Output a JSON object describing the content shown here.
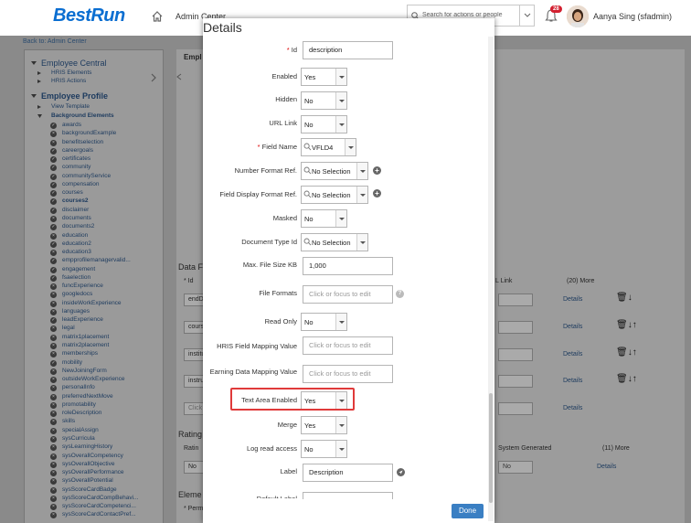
{
  "header": {
    "logo": "BestRun",
    "title": "Admin Center",
    "search_placeholder": "Search for actions or people",
    "notification_count": "28",
    "user_name": "Aanya Sing (sfadmin)"
  },
  "back_link": "Back to: Admin Center",
  "sidebar": {
    "sections": [
      {
        "label": "Employee Central",
        "items": [
          "HRIS Elements",
          "HRIS Actions"
        ]
      },
      {
        "label": "Employee Profile",
        "items": [
          "View Template",
          "Background Elements"
        ]
      }
    ],
    "background_elements": [
      "awards",
      "backgroundExample",
      "benefitselection",
      "careergoals",
      "certificates",
      "community",
      "communityService",
      "compensation",
      "courses",
      "courses2",
      "disclaimer",
      "documents",
      "documents2",
      "education",
      "education2",
      "education3",
      "empprofilemanagervalid...",
      "engagement",
      "fsaelection",
      "funcExperience",
      "googledocs",
      "insideWorkExperience",
      "languages",
      "leadExperience",
      "legal",
      "matrix1placement",
      "matrix2placement",
      "memberships",
      "mobility",
      "NewJoiningForm",
      "outsideWorkExperience",
      "personalInfo",
      "preferredNextMove",
      "promotability",
      "roleDescription",
      "skills",
      "specialAssign",
      "sysCurricula",
      "sysLearningHistory",
      "sysOverallCompetency",
      "sysOverallObjective",
      "sysOverallPerformance",
      "sysOverallPotential",
      "sysScoreCardBadge",
      "sysScoreCardCompBehavi...",
      "sysScoreCardCompetenci...",
      "sysScoreCardContactPref..."
    ]
  },
  "background_page": {
    "header_fragment": "Empl",
    "data_section": "Data F",
    "col_id": "* Id",
    "col_link": "L Link",
    "col_more": "(20) More",
    "rows": [
      "endD",
      "cours",
      "institu",
      "instru"
    ],
    "click_placeholder": "Click",
    "details": "Details",
    "rating_section": "Rating",
    "rating_label": "Ratin",
    "system_generated": "System Generated",
    "more11": "(11) More",
    "no": "No",
    "no_partial": "No",
    "element_section": "Eleme",
    "perm_label": "* Perm"
  },
  "dialog": {
    "title": "Details",
    "fields": [
      {
        "label": "Id",
        "required": true,
        "value": "description"
      },
      {
        "label": "Enabled",
        "value": "Yes"
      },
      {
        "label": "Hidden",
        "value": "No"
      },
      {
        "label": "URL Link",
        "value": "No"
      },
      {
        "label": "Field Name",
        "required": true,
        "value": "VFLD4"
      },
      {
        "label": "Number Format Ref.",
        "value": "No Selection"
      },
      {
        "label": "Field Display Format Ref.",
        "value": "No Selection"
      },
      {
        "label": "Masked",
        "value": "No"
      },
      {
        "label": "Document Type Id",
        "value": "No Selection"
      },
      {
        "label": "Max. File Size KB",
        "value": "1,000"
      },
      {
        "label": "File Formats",
        "placeholder": "Click or focus to edit"
      },
      {
        "label": "Read Only",
        "value": "No"
      },
      {
        "label": "HRIS Field Mapping Value",
        "placeholder": "Click or focus to edit"
      },
      {
        "label": "Earning Data Mapping Value",
        "placeholder": "Click or focus to edit"
      },
      {
        "label": "Text Area Enabled",
        "value": "Yes"
      },
      {
        "label": "Merge",
        "value": "Yes"
      },
      {
        "label": "Log read access",
        "value": "No"
      },
      {
        "label": "Label",
        "value": "Description"
      },
      {
        "label": "Default Label",
        "value": ""
      }
    ],
    "done_label": "Done"
  },
  "colors": {
    "brand": "#0a6ed1",
    "highlight": "#e03a3a",
    "done_button": "#3a7fc3"
  }
}
